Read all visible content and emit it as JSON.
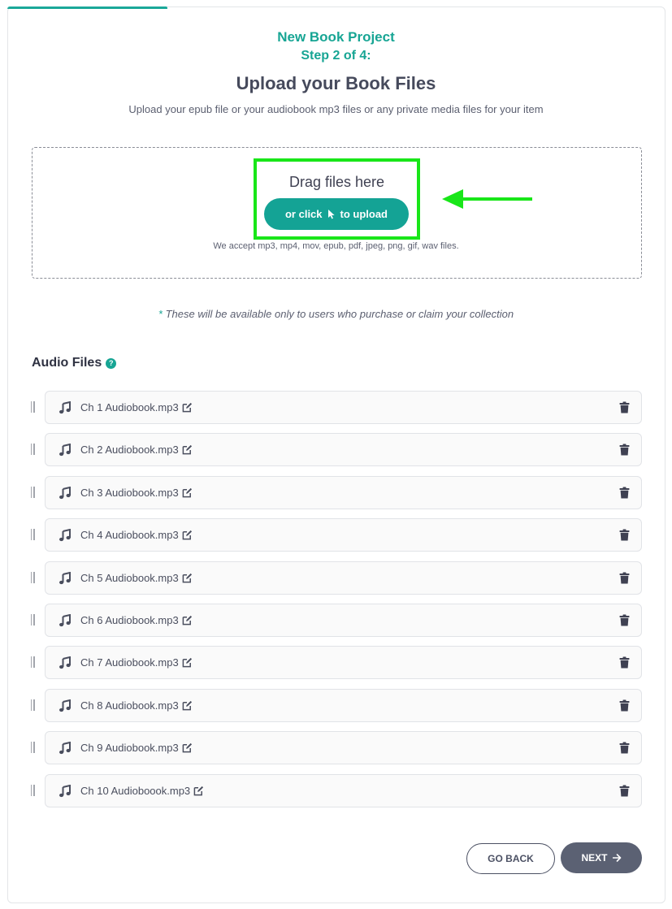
{
  "header": {
    "project_title": "New Book Project",
    "step_label": "Step 2 of 4:",
    "page_title": "Upload your Book Files",
    "subtitle": "Upload your epub file or your audiobook mp3 files or any private media files for your item",
    "progress_fraction": 0.25
  },
  "dropzone": {
    "drag_text": "Drag files here",
    "button_prefix": "or click",
    "button_suffix": "to upload",
    "accept_text": "We accept mp3, mp4, mov, epub, pdf, jpeg, png, gif, wav files."
  },
  "note": {
    "asterisk": "*",
    "text": "These will be available only to users who purchase or claim your collection"
  },
  "audio": {
    "section_title": "Audio Files",
    "help_icon": "?",
    "files": [
      "Ch 1 Audiobook.mp3",
      "Ch 2 Audiobook.mp3",
      "Ch 3 Audiobook.mp3",
      "Ch 4 Audiobook.mp3",
      "Ch 5 Audiobook.mp3",
      "Ch 6 Audiobook.mp3",
      "Ch 7 Audiobook.mp3",
      "Ch 8 Audiobook.mp3",
      "Ch 9 Audiobook.mp3",
      "Ch 10 Audioboook.mp3"
    ]
  },
  "footer": {
    "back_label": "GO BACK",
    "next_label": "NEXT"
  },
  "colors": {
    "accent": "#17a594",
    "highlight": "#19e619",
    "next_button": "#5b6173"
  },
  "icons": {
    "file_icon": "music-note-icon",
    "edit_icon": "edit-icon",
    "delete_icon": "trash-icon",
    "drag_icon": "drag-handle-icon",
    "next_icon": "arrow-right-icon",
    "cursor_icon": "cursor-icon"
  }
}
